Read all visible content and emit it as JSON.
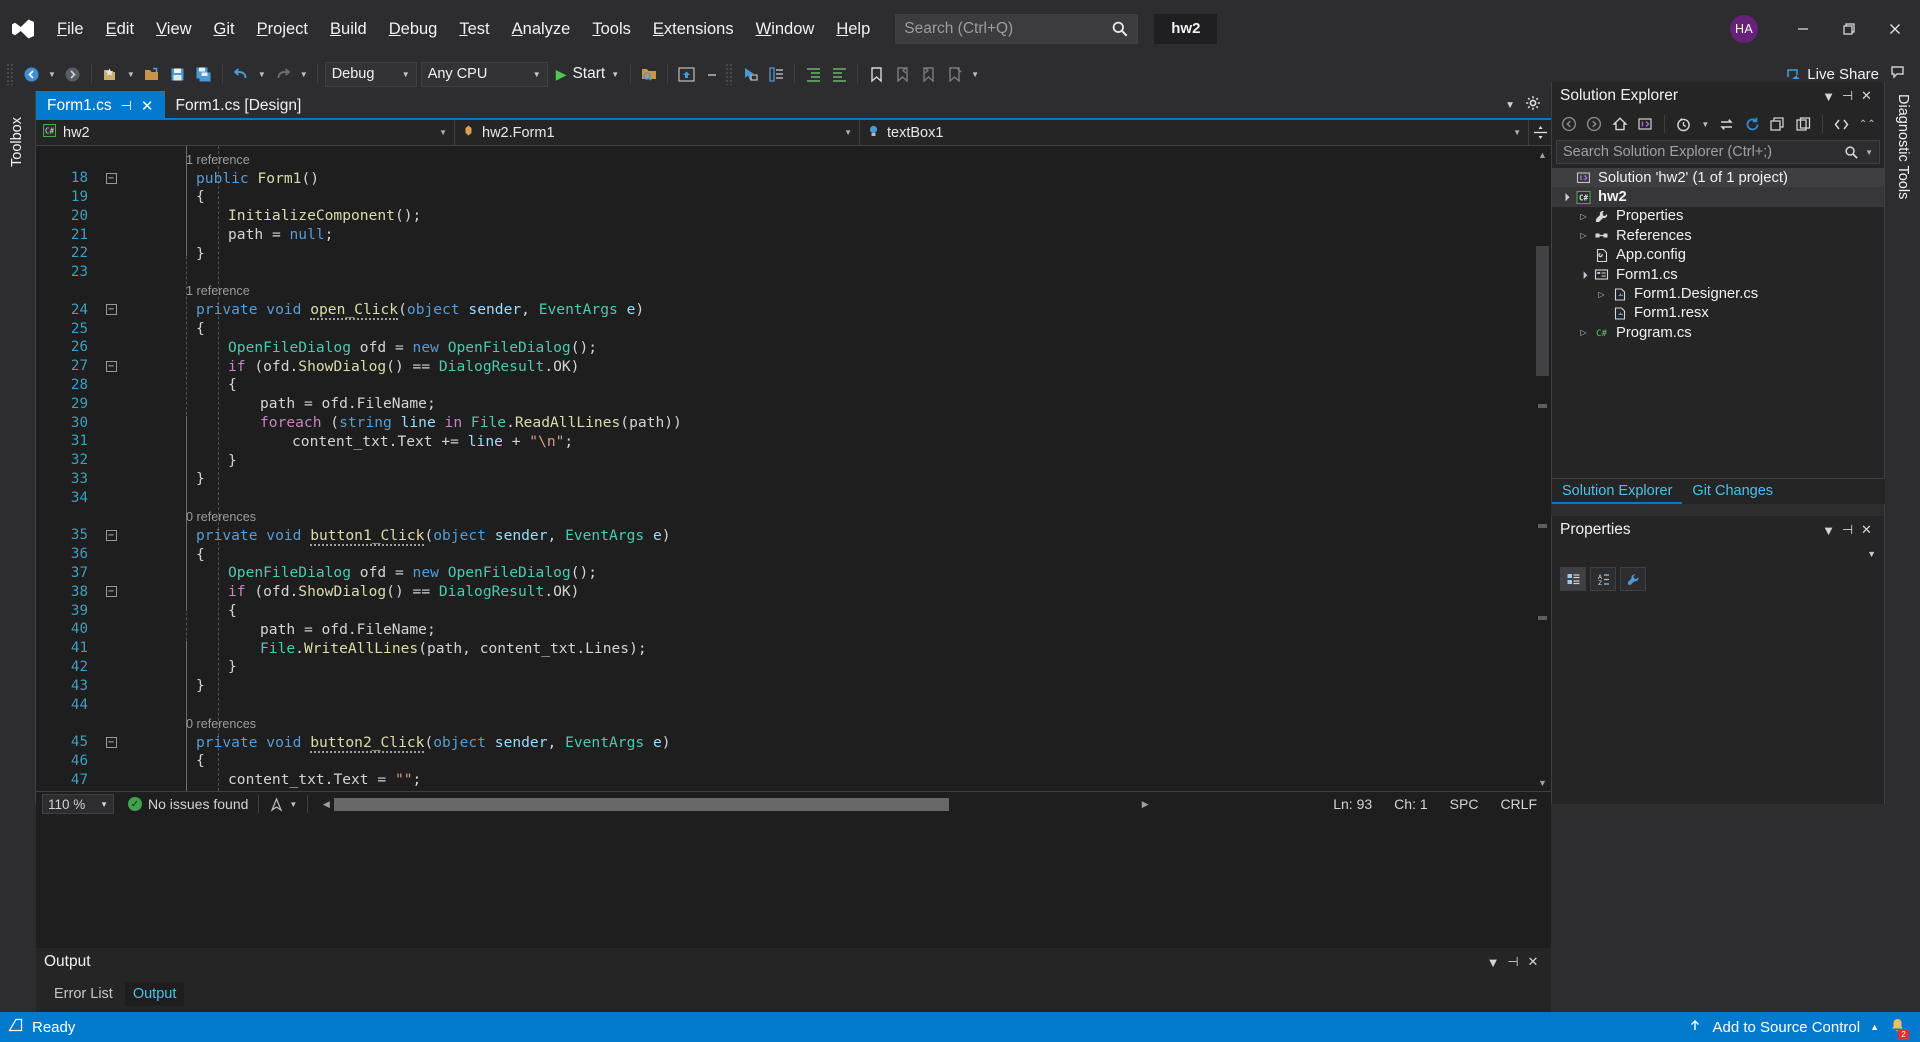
{
  "titlebar": {
    "logo_icon": "visual-studio-logo",
    "menus": [
      "File",
      "Edit",
      "View",
      "Git",
      "Project",
      "Build",
      "Debug",
      "Test",
      "Analyze",
      "Tools",
      "Extensions",
      "Window",
      "Help"
    ],
    "search_placeholder": "Search (Ctrl+Q)",
    "search_value": "",
    "search_icon": "search-icon",
    "project_chip": "hw2",
    "avatar_initials": "HA",
    "avatar_color": "#68217a",
    "minimize_icon": "minimize-icon",
    "restore_icon": "restore-icon",
    "close_icon": "close-icon"
  },
  "toolbar": {
    "back_icon": "navigate-back-icon",
    "forward_icon": "navigate-forward-icon",
    "new_project_icon": "new-project-icon",
    "open_file_icon": "open-file-icon",
    "save_icon": "save-icon",
    "save_all_icon": "save-all-icon",
    "undo_icon": "undo-icon",
    "redo_icon": "redo-icon",
    "config_value": "Debug",
    "platform_value": "Any CPU",
    "start_label": "Start",
    "play_icon": "play-icon",
    "attach_icon": "attach-to-process-icon",
    "preview_icon": "preview-selected-items-icon",
    "selection_icon": "selection-icon",
    "properties_icon": "properties-window-icon",
    "toolbox_icon": "toolbox-icon",
    "indent_icon": "indent-icon",
    "bookmark_icon": "bookmark-icon",
    "prev_bookmark_icon": "previous-bookmark-icon",
    "next_bookmark_icon": "next-bookmark-icon",
    "clear_bookmark_icon": "clear-bookmarks-icon",
    "live_share_label": "Live Share",
    "live_share_icon": "live-share-icon",
    "feedback_icon": "send-feedback-icon"
  },
  "left_strip": {
    "toolbox_label": "Toolbox"
  },
  "right_strip": {
    "diagnostic_label": "Diagnostic Tools"
  },
  "editor": {
    "tabs": [
      {
        "label": "Form1.cs",
        "active": true,
        "pin_icon": "pin-icon",
        "close_icon": "close-icon"
      },
      {
        "label": "Form1.cs [Design]",
        "active": false
      }
    ],
    "tab_dropdown_icon": "chevron-down-icon",
    "tab_settings_icon": "gear-icon",
    "nav": {
      "project": "hw2",
      "project_icon": "csharp-project-icon",
      "type": "hw2.Form1",
      "type_icon": "class-icon",
      "member": "textBox1",
      "member_icon": "field-icon",
      "split_icon": "split-view-icon"
    },
    "lines": [
      {
        "num": "",
        "lens": "1 reference"
      },
      {
        "num": "18",
        "fold": "-",
        "tokens": [
          {
            "t": "public ",
            "c": "k"
          },
          {
            "t": "Form1",
            "c": "m"
          },
          {
            "t": "()",
            "c": "d"
          }
        ],
        "indent": 2
      },
      {
        "num": "19",
        "tokens": [
          {
            "t": "{",
            "c": "d"
          }
        ],
        "indent": 2
      },
      {
        "num": "20",
        "tokens": [
          {
            "t": "InitializeComponent",
            "c": "m"
          },
          {
            "t": "();",
            "c": "d"
          }
        ],
        "indent": 3
      },
      {
        "num": "21",
        "tokens": [
          {
            "t": "path ",
            "c": "d"
          },
          {
            "t": "= ",
            "c": "d"
          },
          {
            "t": "null",
            "c": "k"
          },
          {
            "t": ";",
            "c": "d"
          }
        ],
        "indent": 3
      },
      {
        "num": "22",
        "tokens": [
          {
            "t": "}",
            "c": "d"
          }
        ],
        "indent": 2
      },
      {
        "num": "23",
        "tokens": []
      },
      {
        "num": "",
        "lens": "1 reference"
      },
      {
        "num": "24",
        "fold": "-",
        "tokens": [
          {
            "t": "private ",
            "c": "k"
          },
          {
            "t": "void ",
            "c": "k"
          },
          {
            "t": "open_Click",
            "c": "m sq"
          },
          {
            "t": "(",
            "c": "d"
          },
          {
            "t": "object ",
            "c": "k"
          },
          {
            "t": "sender",
            "c": "p"
          },
          {
            "t": ", ",
            "c": "d"
          },
          {
            "t": "EventArgs ",
            "c": "t"
          },
          {
            "t": "e",
            "c": "p"
          },
          {
            "t": ")",
            "c": "d"
          }
        ],
        "indent": 2
      },
      {
        "num": "25",
        "tokens": [
          {
            "t": "{",
            "c": "d"
          }
        ],
        "indent": 2
      },
      {
        "num": "26",
        "tokens": [
          {
            "t": "OpenFileDialog ",
            "c": "t"
          },
          {
            "t": "ofd ",
            "c": "d"
          },
          {
            "t": "= ",
            "c": "d"
          },
          {
            "t": "new ",
            "c": "k"
          },
          {
            "t": "OpenFileDialog",
            "c": "t"
          },
          {
            "t": "();",
            "c": "d"
          }
        ],
        "indent": 3
      },
      {
        "num": "27",
        "fold": "-",
        "tokens": [
          {
            "t": "if ",
            "c": "kc"
          },
          {
            "t": "(ofd.",
            "c": "d"
          },
          {
            "t": "ShowDialog",
            "c": "m"
          },
          {
            "t": "() == ",
            "c": "d"
          },
          {
            "t": "DialogResult",
            "c": "t"
          },
          {
            "t": ".OK)",
            "c": "d"
          }
        ],
        "indent": 3
      },
      {
        "num": "28",
        "tokens": [
          {
            "t": "{",
            "c": "d"
          }
        ],
        "indent": 3
      },
      {
        "num": "29",
        "tokens": [
          {
            "t": "path ",
            "c": "d"
          },
          {
            "t": "= ofd.",
            "c": "d"
          },
          {
            "t": "FileName",
            "c": "d"
          },
          {
            "t": ";",
            "c": "d"
          }
        ],
        "indent": 4
      },
      {
        "num": "30",
        "tokens": [
          {
            "t": "foreach ",
            "c": "kc"
          },
          {
            "t": "(",
            "c": "d"
          },
          {
            "t": "string ",
            "c": "k"
          },
          {
            "t": "line ",
            "c": "p"
          },
          {
            "t": "in ",
            "c": "kc"
          },
          {
            "t": "File",
            "c": "t"
          },
          {
            "t": ".",
            "c": "d"
          },
          {
            "t": "ReadAllLines",
            "c": "m"
          },
          {
            "t": "(path))",
            "c": "d"
          }
        ],
        "indent": 4
      },
      {
        "num": "31",
        "tokens": [
          {
            "t": "content_txt",
            "c": "d"
          },
          {
            "t": ".",
            "c": "d"
          },
          {
            "t": "Text ",
            "c": "d"
          },
          {
            "t": "+= ",
            "c": "d"
          },
          {
            "t": "line ",
            "c": "p"
          },
          {
            "t": "+ ",
            "c": "d"
          },
          {
            "t": "\"\\n\"",
            "c": "s"
          },
          {
            "t": ";",
            "c": "d"
          }
        ],
        "indent": 5
      },
      {
        "num": "32",
        "tokens": [
          {
            "t": "}",
            "c": "d"
          }
        ],
        "indent": 3
      },
      {
        "num": "33",
        "tokens": [
          {
            "t": "}",
            "c": "d"
          }
        ],
        "indent": 2
      },
      {
        "num": "34",
        "tokens": []
      },
      {
        "num": "",
        "lens": "0 references"
      },
      {
        "num": "35",
        "fold": "-",
        "tokens": [
          {
            "t": "private ",
            "c": "k"
          },
          {
            "t": "void ",
            "c": "k"
          },
          {
            "t": "button1_Click",
            "c": "m sq"
          },
          {
            "t": "(",
            "c": "d"
          },
          {
            "t": "object ",
            "c": "k"
          },
          {
            "t": "sender",
            "c": "p"
          },
          {
            "t": ", ",
            "c": "d"
          },
          {
            "t": "EventArgs ",
            "c": "t"
          },
          {
            "t": "e",
            "c": "p"
          },
          {
            "t": ")",
            "c": "d"
          }
        ],
        "indent": 2
      },
      {
        "num": "36",
        "tokens": [
          {
            "t": "{",
            "c": "d"
          }
        ],
        "indent": 2
      },
      {
        "num": "37",
        "tokens": [
          {
            "t": "OpenFileDialog ",
            "c": "t"
          },
          {
            "t": "ofd ",
            "c": "d"
          },
          {
            "t": "= ",
            "c": "d"
          },
          {
            "t": "new ",
            "c": "k"
          },
          {
            "t": "OpenFileDialog",
            "c": "t"
          },
          {
            "t": "();",
            "c": "d"
          }
        ],
        "indent": 3
      },
      {
        "num": "38",
        "fold": "-",
        "tokens": [
          {
            "t": "if ",
            "c": "kc"
          },
          {
            "t": "(ofd.",
            "c": "d"
          },
          {
            "t": "ShowDialog",
            "c": "m"
          },
          {
            "t": "() == ",
            "c": "d"
          },
          {
            "t": "DialogResult",
            "c": "t"
          },
          {
            "t": ".OK)",
            "c": "d"
          }
        ],
        "indent": 3
      },
      {
        "num": "39",
        "tokens": [
          {
            "t": "{",
            "c": "d"
          }
        ],
        "indent": 3
      },
      {
        "num": "40",
        "tokens": [
          {
            "t": "path ",
            "c": "d"
          },
          {
            "t": "= ofd.",
            "c": "d"
          },
          {
            "t": "FileName;",
            "c": "d"
          }
        ],
        "indent": 4
      },
      {
        "num": "41",
        "tokens": [
          {
            "t": "File",
            "c": "t"
          },
          {
            "t": ".",
            "c": "d"
          },
          {
            "t": "WriteAllLines",
            "c": "m"
          },
          {
            "t": "(path, content_txt.",
            "c": "d"
          },
          {
            "t": "Lines",
            "c": "d"
          },
          {
            "t": ");",
            "c": "d"
          }
        ],
        "indent": 4
      },
      {
        "num": "42",
        "tokens": [
          {
            "t": "}",
            "c": "d"
          }
        ],
        "indent": 3
      },
      {
        "num": "43",
        "tokens": [
          {
            "t": "}",
            "c": "d"
          }
        ],
        "indent": 2
      },
      {
        "num": "44",
        "tokens": []
      },
      {
        "num": "",
        "lens": "0 references"
      },
      {
        "num": "45",
        "fold": "-",
        "tokens": [
          {
            "t": "private ",
            "c": "k"
          },
          {
            "t": "void ",
            "c": "k"
          },
          {
            "t": "button2_Click",
            "c": "m sq"
          },
          {
            "t": "(",
            "c": "d"
          },
          {
            "t": "object ",
            "c": "k"
          },
          {
            "t": "sender",
            "c": "p"
          },
          {
            "t": ", ",
            "c": "d"
          },
          {
            "t": "EventArgs ",
            "c": "t"
          },
          {
            "t": "e",
            "c": "p"
          },
          {
            "t": ")",
            "c": "d"
          }
        ],
        "indent": 2
      },
      {
        "num": "46",
        "tokens": [
          {
            "t": "{",
            "c": "d"
          }
        ],
        "indent": 2
      },
      {
        "num": "47",
        "tokens": [
          {
            "t": "content_txt",
            "c": "d"
          },
          {
            "t": ".",
            "c": "d"
          },
          {
            "t": "Text ",
            "c": "d"
          },
          {
            "t": "= ",
            "c": "d"
          },
          {
            "t": "\"\"",
            "c": "s"
          },
          {
            "t": ";",
            "c": "d"
          }
        ],
        "indent": 3
      }
    ],
    "status": {
      "zoom": "110 %",
      "issues": "No issues found",
      "issues_icon": "check-circle-icon",
      "nav_icon": "navigate-icon",
      "line": "Ln: 93",
      "col": "Ch: 1",
      "spaces": "SPC",
      "eol": "CRLF"
    }
  },
  "output_panel": {
    "title": "Output",
    "dropdown_icon": "chevron-down-icon",
    "pin_icon": "pin-icon",
    "close_icon": "close-icon",
    "tabs": [
      {
        "label": "Error List",
        "selected": false
      },
      {
        "label": "Output",
        "selected": true
      }
    ]
  },
  "solution_explorer": {
    "title": "Solution Explorer",
    "dropdown_icon": "chevron-down-icon",
    "pin_icon": "pin-icon",
    "close_icon": "close-icon",
    "toolbar_icons": [
      "back-icon",
      "forward-icon",
      "home-icon",
      "solution-icon",
      "pending-changes-icon",
      "sync-with-active-document-icon",
      "refresh-icon",
      "collapse-all-icon",
      "show-all-files-icon",
      "view-code-icon",
      "overflow-icon"
    ],
    "search_placeholder": "Search Solution Explorer (Ctrl+;)",
    "search_value": "",
    "search_icon": "search-icon",
    "tree": [
      {
        "label": "Solution 'hw2' (1 of 1 project)",
        "depth": 0,
        "arrow": "",
        "icon": "solution-icon",
        "state": "sel-a"
      },
      {
        "label": "hw2",
        "depth": 0,
        "arrow": "expanded",
        "icon": "csharp-project-icon",
        "state": "sel-b"
      },
      {
        "label": "Properties",
        "depth": 1,
        "arrow": "collapsed",
        "icon": "wrench-icon",
        "state": ""
      },
      {
        "label": "References",
        "depth": 1,
        "arrow": "collapsed",
        "icon": "references-icon",
        "state": ""
      },
      {
        "label": "App.config",
        "depth": 1,
        "arrow": "",
        "icon": "config-file-icon",
        "state": ""
      },
      {
        "label": "Form1.cs",
        "depth": 1,
        "arrow": "expanded",
        "icon": "form-icon",
        "state": ""
      },
      {
        "label": "Form1.Designer.cs",
        "depth": 2,
        "arrow": "collapsed",
        "icon": "csharp-file-icon",
        "state": ""
      },
      {
        "label": "Form1.resx",
        "depth": 2,
        "arrow": "",
        "icon": "csharp-file-icon",
        "state": ""
      },
      {
        "label": "Program.cs",
        "depth": 1,
        "arrow": "collapsed",
        "icon": "csharp-code-icon",
        "state": ""
      }
    ],
    "dock_tabs": [
      {
        "label": "Solution Explorer",
        "active": true
      },
      {
        "label": "Git Changes",
        "active": false
      }
    ]
  },
  "properties_panel": {
    "title": "Properties",
    "dropdown_icon": "chevron-down-icon",
    "pin_icon": "pin-icon",
    "close_icon": "close-icon",
    "sub_dropdown_icon": "chevron-down-icon",
    "buttons": [
      "categorized-icon",
      "alphabetical-icon",
      "properties-icon"
    ]
  },
  "statusbar": {
    "ready": "Ready",
    "ready_icon": "status-icon",
    "source_control": "Add to Source Control",
    "source_control_icon": "upload-icon",
    "expand_icon": "chevron-up-icon",
    "notification_icon": "bell-icon",
    "notification_count": "2",
    "accent_color": "#007acc"
  }
}
